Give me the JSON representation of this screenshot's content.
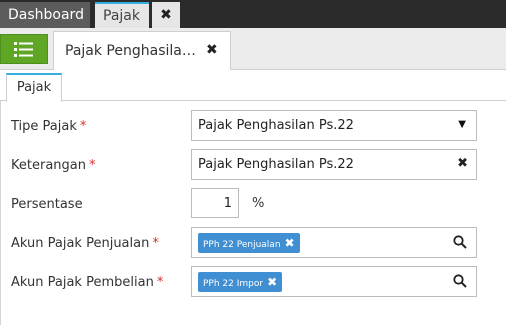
{
  "topbar": {
    "tabs": [
      {
        "label": "Dashboard"
      },
      {
        "label": "Pajak"
      }
    ],
    "close_label": "✖"
  },
  "toolbar": {
    "menu_icon": "list-icon",
    "tab_label": "Pajak Penghasila…",
    "tab_close_label": "✖"
  },
  "section": {
    "tab_label": "Pajak"
  },
  "form": {
    "tipe_pajak": {
      "label": "Tipe Pajak",
      "required_mark": "*",
      "value": "Pajak Penghasilan Ps.22",
      "arrow": "▼"
    },
    "keterangan": {
      "label": "Keterangan",
      "required_mark": "*",
      "value": "Pajak Penghasilan Ps.22",
      "clear": "✖"
    },
    "persentase": {
      "label": "Persentase",
      "value": "1",
      "unit": "%"
    },
    "akun_penjualan": {
      "label": "Akun Pajak Penjualan",
      "required_mark": "*",
      "tag": "PPh 22 Penjualan",
      "tag_remove": "✖"
    },
    "akun_pembelian": {
      "label": "Akun Pajak Pembelian",
      "required_mark": "*",
      "tag": "PPh 22 Impor",
      "tag_remove": "✖"
    }
  },
  "colors": {
    "accent_green": "#5fa624",
    "tag_blue": "#3f8fd2",
    "tab_highlight": "#37aee0",
    "required_red": "#d9302c"
  }
}
